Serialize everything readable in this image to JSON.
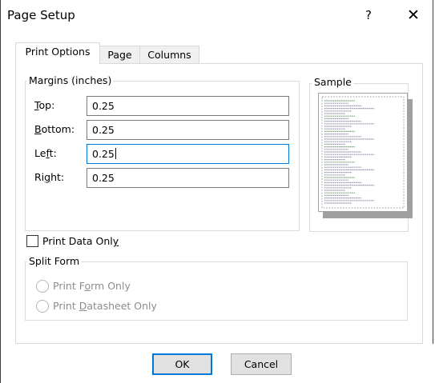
{
  "dialog": {
    "title": "Page Setup",
    "help_label": "?",
    "close_label": "✕"
  },
  "tabs": [
    {
      "label": "Print Options",
      "active": true
    },
    {
      "label": "Page",
      "active": false
    },
    {
      "label": "Columns",
      "active": false
    }
  ],
  "margins": {
    "group_label": "Margins (inches)",
    "top": {
      "label_pre": "",
      "label_key": "T",
      "label_post": "op:",
      "value": "0.25"
    },
    "bottom": {
      "label_pre": "",
      "label_key": "B",
      "label_post": "ottom:",
      "value": "0.25"
    },
    "left": {
      "label_pre": "Le",
      "label_key": "f",
      "label_post": "t:",
      "value": "0.25"
    },
    "right": {
      "label_pre": "Ri",
      "label_key": "g",
      "label_post": "ht:",
      "value": "0.25"
    }
  },
  "sample": {
    "group_label": "Sample"
  },
  "print_data_only": {
    "label_pre": "Print Data Onl",
    "label_key": "y",
    "label_post": "",
    "checked": false
  },
  "split_form": {
    "group_label": "Split Form",
    "options": [
      {
        "label_pre": "Print F",
        "label_key": "o",
        "label_post": "rm Only",
        "selected": false
      },
      {
        "label_pre": "Print ",
        "label_key": "D",
        "label_post": "atasheet Only",
        "selected": false
      }
    ]
  },
  "buttons": {
    "ok_label": "OK",
    "cancel_label": "Cancel"
  },
  "colors": {
    "accent": "#0078d7",
    "disabled_text": "#8c8c8c"
  }
}
